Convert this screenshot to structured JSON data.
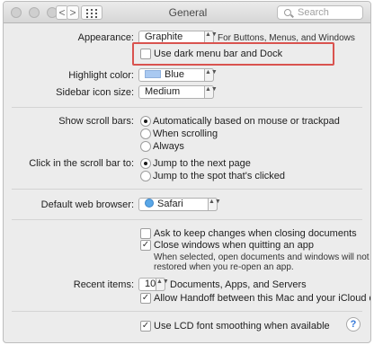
{
  "window": {
    "title": "General",
    "search_placeholder": "Search",
    "back_glyph": "<",
    "forward_glyph": ">"
  },
  "appearance": {
    "label": "Appearance:",
    "value": "Graphite",
    "note": "For Buttons, Menus, and Windows"
  },
  "dark_menu": {
    "label": "Use dark menu bar and Dock",
    "checked": false
  },
  "highlight": {
    "label": "Highlight color:",
    "value": "Blue",
    "swatch_color": "#a9c9f1"
  },
  "sidebar_icon": {
    "label": "Sidebar icon size:",
    "value": "Medium"
  },
  "scroll_bars": {
    "label": "Show scroll bars:",
    "options": [
      "Automatically based on mouse or trackpad",
      "When scrolling",
      "Always"
    ],
    "selected_index": 0
  },
  "scroll_click": {
    "label": "Click in the scroll bar to:",
    "options": [
      "Jump to the next page",
      "Jump to the spot that's clicked"
    ],
    "selected_index": 0
  },
  "browser": {
    "label": "Default web browser:",
    "value": "Safari"
  },
  "documents": {
    "ask_keep_label": "Ask to keep changes when closing documents",
    "ask_keep_checked": false,
    "close_windows_label": "Close windows when quitting an app",
    "close_windows_checked": true,
    "close_windows_note_line1": "When selected, open documents and windows will not be",
    "close_windows_note_line2": "restored when you re-open an app."
  },
  "recent_items": {
    "label": "Recent items:",
    "value": "10",
    "suffix": "Documents, Apps, and Servers"
  },
  "handoff": {
    "label": "Allow Handoff between this Mac and your iCloud devices",
    "checked": true
  },
  "lcd": {
    "label": "Use LCD font smoothing when available",
    "checked": true
  },
  "help": {
    "glyph": "?"
  },
  "check_glyph": "✓",
  "stepper_glyph": "▲▼"
}
